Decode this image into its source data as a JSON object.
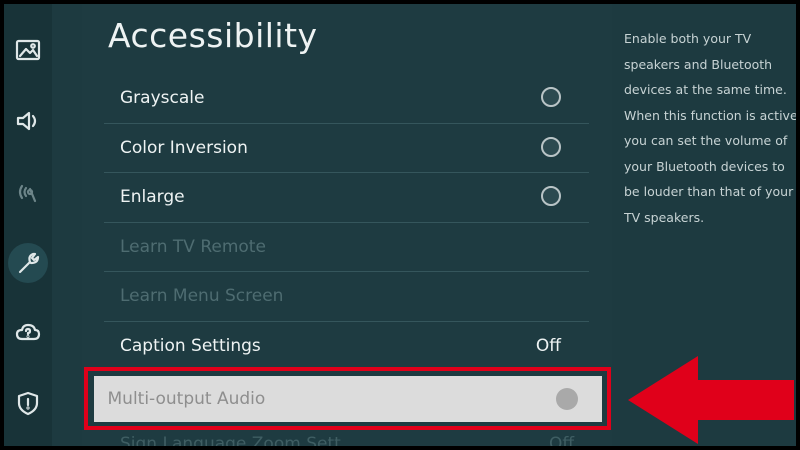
{
  "page": {
    "title": "Accessibility"
  },
  "sidebar": {
    "icons": [
      "picture-icon",
      "sound-icon",
      "broadcast-icon",
      "wrench-icon",
      "support-icon",
      "shield-icon"
    ],
    "active": "wrench-icon"
  },
  "menu": {
    "items": [
      {
        "label": "Grayscale",
        "control": "toggle"
      },
      {
        "label": "Color Inversion",
        "control": "toggle"
      },
      {
        "label": "Enlarge",
        "control": "toggle"
      },
      {
        "label": "Learn TV Remote",
        "control": "none",
        "disabled": true
      },
      {
        "label": "Learn Menu Screen",
        "control": "none",
        "disabled": true
      },
      {
        "label": "Caption Settings",
        "control": "value",
        "value": "Off"
      }
    ],
    "focused": {
      "label": "Multi-output Audio",
      "control": "toggle"
    },
    "next": {
      "label": "Sign Language Zoom Sett",
      "value": "Off"
    }
  },
  "help": {
    "text": "Enable both your TV speakers and Bluetooth devices at the same time. When this function is active you can set the volume of your Bluetooth devices to be louder than that of your TV speakers."
  },
  "colors": {
    "background": "#1d3a40",
    "highlight_border": "#e0001a",
    "arrow": "#e0001a"
  }
}
